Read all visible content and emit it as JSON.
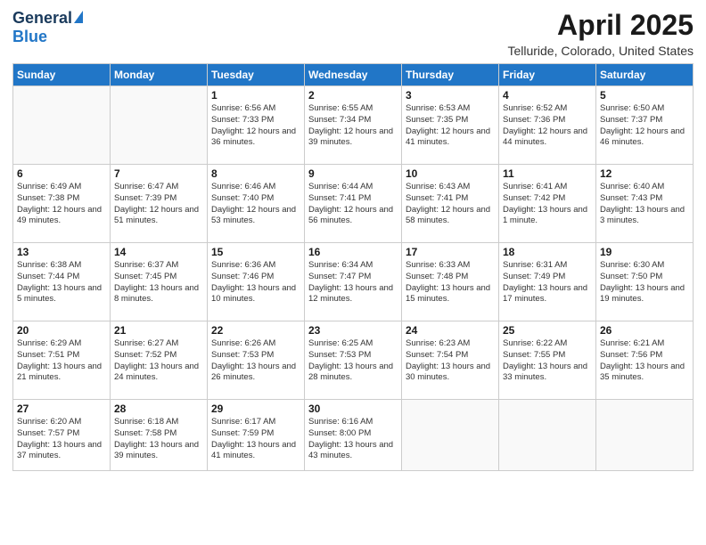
{
  "header": {
    "logo_general": "General",
    "logo_blue": "Blue",
    "title": "April 2025",
    "subtitle": "Telluride, Colorado, United States"
  },
  "weekdays": [
    "Sunday",
    "Monday",
    "Tuesday",
    "Wednesday",
    "Thursday",
    "Friday",
    "Saturday"
  ],
  "weeks": [
    [
      {
        "day": "",
        "info": "",
        "empty": true
      },
      {
        "day": "",
        "info": "",
        "empty": true
      },
      {
        "day": "1",
        "info": "Sunrise: 6:56 AM\nSunset: 7:33 PM\nDaylight: 12 hours and 36 minutes.",
        "empty": false
      },
      {
        "day": "2",
        "info": "Sunrise: 6:55 AM\nSunset: 7:34 PM\nDaylight: 12 hours and 39 minutes.",
        "empty": false
      },
      {
        "day": "3",
        "info": "Sunrise: 6:53 AM\nSunset: 7:35 PM\nDaylight: 12 hours and 41 minutes.",
        "empty": false
      },
      {
        "day": "4",
        "info": "Sunrise: 6:52 AM\nSunset: 7:36 PM\nDaylight: 12 hours and 44 minutes.",
        "empty": false
      },
      {
        "day": "5",
        "info": "Sunrise: 6:50 AM\nSunset: 7:37 PM\nDaylight: 12 hours and 46 minutes.",
        "empty": false
      }
    ],
    [
      {
        "day": "6",
        "info": "Sunrise: 6:49 AM\nSunset: 7:38 PM\nDaylight: 12 hours and 49 minutes.",
        "empty": false
      },
      {
        "day": "7",
        "info": "Sunrise: 6:47 AM\nSunset: 7:39 PM\nDaylight: 12 hours and 51 minutes.",
        "empty": false
      },
      {
        "day": "8",
        "info": "Sunrise: 6:46 AM\nSunset: 7:40 PM\nDaylight: 12 hours and 53 minutes.",
        "empty": false
      },
      {
        "day": "9",
        "info": "Sunrise: 6:44 AM\nSunset: 7:41 PM\nDaylight: 12 hours and 56 minutes.",
        "empty": false
      },
      {
        "day": "10",
        "info": "Sunrise: 6:43 AM\nSunset: 7:41 PM\nDaylight: 12 hours and 58 minutes.",
        "empty": false
      },
      {
        "day": "11",
        "info": "Sunrise: 6:41 AM\nSunset: 7:42 PM\nDaylight: 13 hours and 1 minute.",
        "empty": false
      },
      {
        "day": "12",
        "info": "Sunrise: 6:40 AM\nSunset: 7:43 PM\nDaylight: 13 hours and 3 minutes.",
        "empty": false
      }
    ],
    [
      {
        "day": "13",
        "info": "Sunrise: 6:38 AM\nSunset: 7:44 PM\nDaylight: 13 hours and 5 minutes.",
        "empty": false
      },
      {
        "day": "14",
        "info": "Sunrise: 6:37 AM\nSunset: 7:45 PM\nDaylight: 13 hours and 8 minutes.",
        "empty": false
      },
      {
        "day": "15",
        "info": "Sunrise: 6:36 AM\nSunset: 7:46 PM\nDaylight: 13 hours and 10 minutes.",
        "empty": false
      },
      {
        "day": "16",
        "info": "Sunrise: 6:34 AM\nSunset: 7:47 PM\nDaylight: 13 hours and 12 minutes.",
        "empty": false
      },
      {
        "day": "17",
        "info": "Sunrise: 6:33 AM\nSunset: 7:48 PM\nDaylight: 13 hours and 15 minutes.",
        "empty": false
      },
      {
        "day": "18",
        "info": "Sunrise: 6:31 AM\nSunset: 7:49 PM\nDaylight: 13 hours and 17 minutes.",
        "empty": false
      },
      {
        "day": "19",
        "info": "Sunrise: 6:30 AM\nSunset: 7:50 PM\nDaylight: 13 hours and 19 minutes.",
        "empty": false
      }
    ],
    [
      {
        "day": "20",
        "info": "Sunrise: 6:29 AM\nSunset: 7:51 PM\nDaylight: 13 hours and 21 minutes.",
        "empty": false
      },
      {
        "day": "21",
        "info": "Sunrise: 6:27 AM\nSunset: 7:52 PM\nDaylight: 13 hours and 24 minutes.",
        "empty": false
      },
      {
        "day": "22",
        "info": "Sunrise: 6:26 AM\nSunset: 7:53 PM\nDaylight: 13 hours and 26 minutes.",
        "empty": false
      },
      {
        "day": "23",
        "info": "Sunrise: 6:25 AM\nSunset: 7:53 PM\nDaylight: 13 hours and 28 minutes.",
        "empty": false
      },
      {
        "day": "24",
        "info": "Sunrise: 6:23 AM\nSunset: 7:54 PM\nDaylight: 13 hours and 30 minutes.",
        "empty": false
      },
      {
        "day": "25",
        "info": "Sunrise: 6:22 AM\nSunset: 7:55 PM\nDaylight: 13 hours and 33 minutes.",
        "empty": false
      },
      {
        "day": "26",
        "info": "Sunrise: 6:21 AM\nSunset: 7:56 PM\nDaylight: 13 hours and 35 minutes.",
        "empty": false
      }
    ],
    [
      {
        "day": "27",
        "info": "Sunrise: 6:20 AM\nSunset: 7:57 PM\nDaylight: 13 hours and 37 minutes.",
        "empty": false
      },
      {
        "day": "28",
        "info": "Sunrise: 6:18 AM\nSunset: 7:58 PM\nDaylight: 13 hours and 39 minutes.",
        "empty": false
      },
      {
        "day": "29",
        "info": "Sunrise: 6:17 AM\nSunset: 7:59 PM\nDaylight: 13 hours and 41 minutes.",
        "empty": false
      },
      {
        "day": "30",
        "info": "Sunrise: 6:16 AM\nSunset: 8:00 PM\nDaylight: 13 hours and 43 minutes.",
        "empty": false
      },
      {
        "day": "",
        "info": "",
        "empty": true
      },
      {
        "day": "",
        "info": "",
        "empty": true
      },
      {
        "day": "",
        "info": "",
        "empty": true
      }
    ]
  ]
}
